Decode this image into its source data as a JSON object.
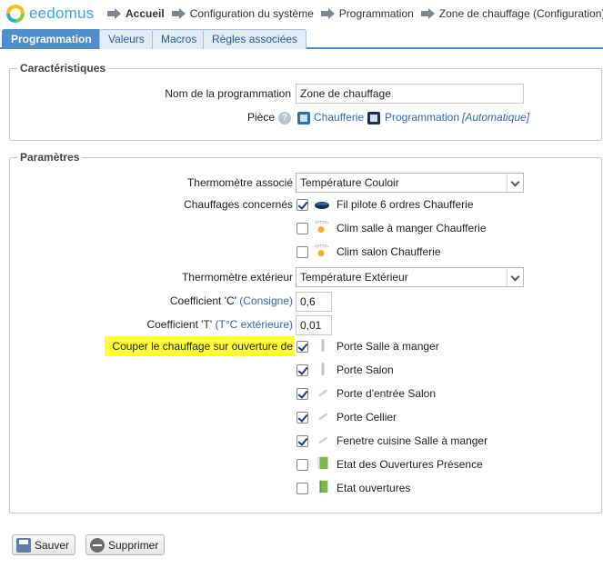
{
  "app": {
    "name": "eedomus"
  },
  "breadcrumb": [
    {
      "label": "Accueil",
      "active": true
    },
    {
      "label": "Configuration du système",
      "active": false
    },
    {
      "label": "Programmation",
      "active": false
    },
    {
      "label": "Zone de chauffage (Configuration)",
      "active": false
    }
  ],
  "tabs": [
    {
      "label": "Programmation",
      "active": true
    },
    {
      "label": "Valeurs",
      "active": false
    },
    {
      "label": "Macros",
      "active": false
    },
    {
      "label": "Règles associées",
      "active": false
    }
  ],
  "caracteristiques": {
    "legend": "Caractéristiques",
    "name_label": "Nom de la programmation",
    "name_value": "Zone de chauffage",
    "piece_label": "Pièce",
    "piece_room": "Chaufferie",
    "piece_program": "Programmation",
    "piece_mode": "[Automatique]"
  },
  "parametres": {
    "legend": "Paramètres",
    "thermo_assoc_label": "Thermomètre associé",
    "thermo_assoc_value": "Température Couloir",
    "chauffages_label": "Chauffages concernés",
    "chauffages": [
      {
        "label": "Fil pilote 6 ordres Chaufferie",
        "checked": true,
        "icon": "heater-icon"
      },
      {
        "label": "Clim salle à manger Chaufferie",
        "checked": false,
        "icon": "http-sensor-icon"
      },
      {
        "label": "Clim salon Chaufferie",
        "checked": false,
        "icon": "http-sensor-icon"
      }
    ],
    "thermo_ext_label": "Thermomètre extérieur",
    "thermo_ext_value": "Température Extérieur",
    "coef_c_label": "Coefficient 'C'",
    "coef_c_link": "(Consigne)",
    "coef_c_value": "0,6",
    "coef_t_label": "Coefficient 'T'",
    "coef_t_link": "(T°C extérieure)",
    "coef_t_value": "0,01",
    "couper_label": "Couper le chauffage sur ouverture de",
    "ouvertures": [
      {
        "label": "Porte Salle à manger",
        "checked": true,
        "icon": "door-sensor-icon"
      },
      {
        "label": "Porte Salon",
        "checked": true,
        "icon": "door-sensor-icon"
      },
      {
        "label": "Porte d'entrée Salon",
        "checked": true,
        "icon": "door-sensor-icon"
      },
      {
        "label": "Porte Cellier",
        "checked": true,
        "icon": "door-sensor-icon"
      },
      {
        "label": "Fenetre cuisine Salle à manger",
        "checked": true,
        "icon": "window-sensor-icon"
      },
      {
        "label": "Etat des Ouvertures Présence",
        "checked": false,
        "icon": "green-door-icon"
      },
      {
        "label": "Etat ouvertures",
        "checked": false,
        "icon": "green-door-icon"
      }
    ]
  },
  "buttons": {
    "save": "Sauver",
    "delete": "Supprimer"
  },
  "colors": {
    "accent": "#4f8ec9",
    "highlight": "#ffff33",
    "link": "#3a66a8"
  }
}
